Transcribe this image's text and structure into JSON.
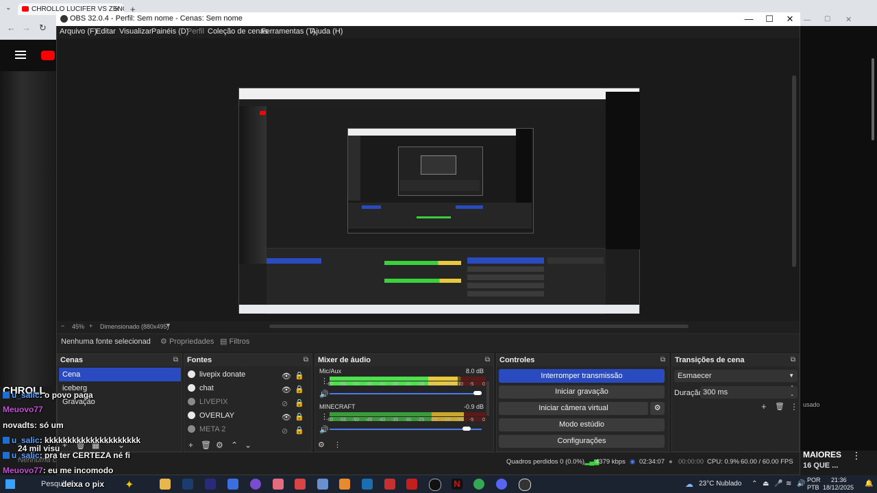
{
  "browser": {
    "tab_title": "CHROLLO LUCIFER VS ZENO E"
  },
  "obs": {
    "window_title": "OBS 32.0.4 - Perfil: Sem nome - Cenas: Sem nome",
    "menu": [
      "Arquivo (F)",
      "Editar",
      "Visualizar",
      "Painéis (D)",
      "Perfil",
      "Coleção de cenas",
      "Ferramentas (T)",
      "Ajuda (H)"
    ],
    "preview": {
      "zoom": "45%",
      "scale_mode": "Dimensionado (880x495)"
    },
    "source_toolbar": {
      "no_source": "Nenhuma fonte selecionad",
      "properties": "Propriedades",
      "filters": "Filtros"
    },
    "scenes": {
      "title": "Cenas",
      "items": [
        "Cena",
        "iceberg",
        "Gravação"
      ]
    },
    "sources": {
      "title": "Fontes",
      "items": [
        "livepix donate",
        "chat",
        "LIVEPIX",
        "OVERLAY",
        "META 2"
      ]
    },
    "mixer": {
      "title": "Mixer de áudio",
      "channels": [
        {
          "name": "Mic/Aux",
          "db": "8.0 dB",
          "level": 0.82,
          "volume": 1.0
        },
        {
          "name": "MINECRAFT",
          "db": "-0.9 dB",
          "level": 0.86,
          "volume": 0.93
        }
      ],
      "ticks": [
        "-60",
        "-55",
        "-50",
        "-45",
        "-40",
        "-35",
        "-30",
        "-25",
        "-20",
        "-15",
        "-10",
        "-5",
        "0"
      ]
    },
    "controls": {
      "title": "Controles",
      "stop_stream": "Interromper transmissão",
      "start_record": "Iniciar gravação",
      "virtual_cam": "Iniciar câmera virtual",
      "studio_mode": "Modo estúdio",
      "settings": "Configurações"
    },
    "transitions": {
      "title": "Transições de cena",
      "selected": "Esmaecer",
      "duration_label": "Duração",
      "duration": "300 ms"
    },
    "status": {
      "dropped": "Quadros perdidos 0 (0.0%)",
      "bitrate": "4379 kbps",
      "stream_time": "02:34:07",
      "rec_time": "00:00:00",
      "cpu": "CPU: 0.9%",
      "fps": "60.00 / 60.00 FPS"
    }
  },
  "chat": {
    "partial_title": "CHROLL",
    "lines": [
      {
        "user": "u_salic",
        "msg": ": o povo paga"
      },
      {
        "user": "Meuovo77",
        "msg": ""
      },
      {
        "user": "novadts",
        "msg": ": só um"
      },
      {
        "user": "u_salic",
        "msg": ": kkkkkkkkkkkkkkkkkkkkk"
      },
      {
        "user": "",
        "msg": "24 mil visu"
      },
      {
        "user": "u_salic",
        "msg": ": pra ter CERTEZA né fi"
      },
      {
        "user": "Meuovo77",
        "msg": ": eu me incomodo"
      },
      {
        "user": "",
        "msg": "deixa o pix"
      }
    ],
    "faint_line": "Nenhuma c",
    "right_text": "MAIORES",
    "right_text2": "16 QUE ...",
    "right_small": "usado"
  },
  "taskbar": {
    "search": "Pesquisar",
    "weather": "23°C  Nublado",
    "lang_top": "POR",
    "lang_bottom": "PTB",
    "time": "21:36",
    "date": "18/12/2025"
  }
}
